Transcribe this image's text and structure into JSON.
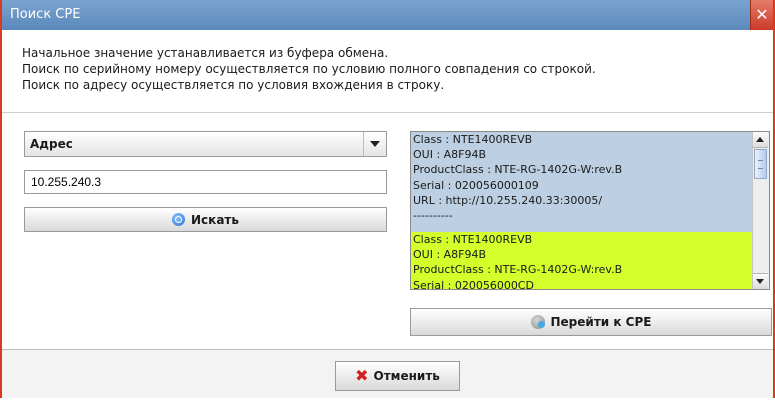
{
  "window": {
    "title": "Поиск CPE",
    "close_glyph": "✕"
  },
  "info": {
    "lines": [
      "Начальное значение устанавливается из буфера обмена.",
      "Поиск по серийному номеру осуществляется по условию полного совпадения со строкой.",
      "Поиск по адресу осуществляется по условия вхождения в строку."
    ]
  },
  "search": {
    "type_selected": "Адрес",
    "value": "10.255.240.3",
    "search_label": "Искать"
  },
  "results": {
    "entries": [
      {
        "lines": [
          "Class : NTE1400REVB",
          "OUI : A8F94B",
          "ProductClass : NTE-RG-1402G-W:rev.B",
          "Serial : 020056000109",
          "URL : http://10.255.240.33:30005/",
          "----------"
        ],
        "background": "#bdd0e3"
      },
      {
        "lines": [
          "Class : NTE1400REVB",
          "OUI : A8F94B",
          "ProductClass : NTE-RG-1402G-W:rev.B",
          "Serial : 020056000CD"
        ],
        "background": "#d5ff2b"
      }
    ],
    "goto_label": "Перейти к CPE"
  },
  "footer": {
    "cancel_label": "Отменить"
  },
  "colors": {
    "title_bar": "#6f9acb",
    "close_button": "#d9503d",
    "highlight": "#d5ff2b",
    "selected_bg": "#bdd0e3"
  }
}
